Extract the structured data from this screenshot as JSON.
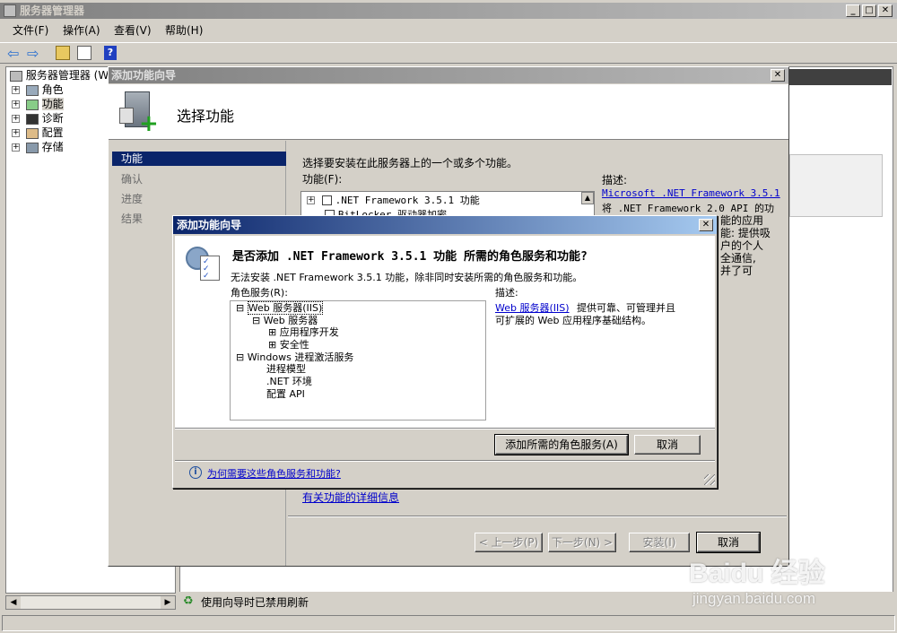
{
  "main_window": {
    "title": "服务器管理器",
    "menu": [
      "文件(F)",
      "操作(A)",
      "查看(V)",
      "帮助(H)"
    ],
    "tree": {
      "root": "服务器管理器 (W",
      "items": [
        "角色",
        "功能",
        "诊断",
        "配置",
        "存储"
      ]
    },
    "status_text": "使用向导时已禁用刷新"
  },
  "wizard": {
    "title": "添加功能向导",
    "header": "选择功能",
    "nav": [
      "功能",
      "确认",
      "进度",
      "结果"
    ],
    "instruction": "选择要安装在此服务器上的一个或多个功能。",
    "features_label": "功能(F):",
    "features": [
      ".NET Framework 3.5.1 功能",
      "BitLocker 驱动器加密"
    ],
    "description_label": "描述:",
    "description_link": "Microsoft .NET Framework 3.5.1",
    "description_lines": [
      "将 .NET Framework 2.0 API 的功",
      "能的应用",
      "能: 提供吸",
      "户的个人",
      "全通信,",
      "并了可"
    ],
    "more_info_link": "有关功能的详细信息",
    "buttons": {
      "prev": "< 上一步(P)",
      "next": "下一步(N) >",
      "install": "安装(I)",
      "cancel": "取消"
    }
  },
  "dialog": {
    "title": "添加功能向导",
    "heading": "是否添加 .NET Framework 3.5.1 功能 所需的角色服务和功能?",
    "subtext": "无法安装 .NET Framework 3.5.1 功能，除非同时安装所需的角色服务和功能。",
    "roles_label": "角色服务(R):",
    "roles": [
      {
        "label": "Web 服务器(IIS)",
        "expander": "⊟"
      },
      {
        "label": "Web 服务器",
        "expander": "⊟"
      },
      {
        "label": "应用程序开发",
        "expander": "⊞"
      },
      {
        "label": "安全性",
        "expander": "⊞"
      },
      {
        "label": "Windows 进程激活服务",
        "expander": "⊟"
      },
      {
        "label": "进程模型",
        "expander": ""
      },
      {
        "label": ".NET 环境",
        "expander": ""
      },
      {
        "label": "配置 API",
        "expander": ""
      }
    ],
    "desc_label": "描述:",
    "desc_link": "Web 服务器(IIS)",
    "desc_text_1": "提供可靠、可管理并且",
    "desc_text_2": "可扩展的 Web 应用程序基础结构。",
    "add_button": "添加所需的角色服务(A)",
    "cancel_button": "取消",
    "help_link": "为何需要这些角色服务和功能?"
  },
  "watermark": {
    "brand": "Baidu 经验",
    "url": "jingyan.baidu.com"
  }
}
